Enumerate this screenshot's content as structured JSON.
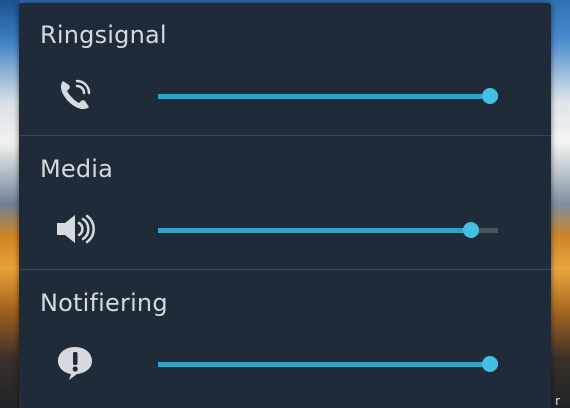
{
  "dialog": {
    "sections": [
      {
        "title": "Ringsignal",
        "icon": "phone-ringing-icon",
        "level": 1.0
      },
      {
        "title": "Media",
        "icon": "speaker-volume-icon",
        "level": 0.92
      },
      {
        "title": "Notifiering",
        "icon": "notification-alert-icon",
        "level": 1.0
      }
    ]
  },
  "colors": {
    "dialog_background": "#1f2b38",
    "slider_fill": "#2fa3c7",
    "slider_thumb": "#43bfe2",
    "slider_track": "#4b5560",
    "text": "#d6d9dd"
  },
  "background": {
    "corner_text": "r"
  }
}
